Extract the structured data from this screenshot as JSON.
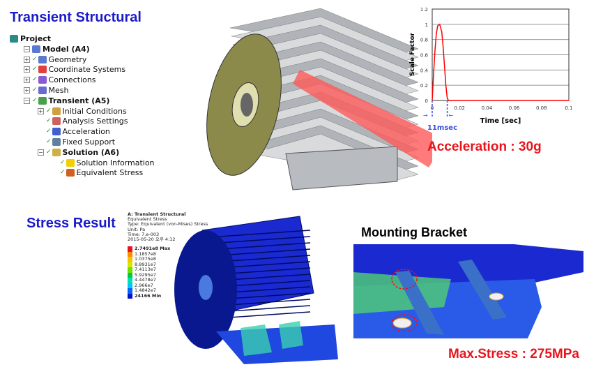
{
  "titles": {
    "transient": "Transient Structural",
    "stress": "Stress Result",
    "bracket": "Mounting Bracket"
  },
  "tree": [
    {
      "label": "Project",
      "bold": true,
      "icon": "project-icon"
    },
    {
      "label": "Model (A4)",
      "bold": true,
      "icon": "model-icon"
    },
    {
      "label": "Geometry",
      "icon": "geometry-icon"
    },
    {
      "label": "Coordinate Systems",
      "icon": "coordinate-systems-icon"
    },
    {
      "label": "Connections",
      "icon": "connections-icon"
    },
    {
      "label": "Mesh",
      "icon": "mesh-icon"
    },
    {
      "label": "Transient (A5)",
      "bold": true,
      "icon": "transient-icon"
    },
    {
      "label": "Initial Conditions",
      "icon": "initial-conditions-icon"
    },
    {
      "label": "Analysis Settings",
      "icon": "analysis-settings-icon"
    },
    {
      "label": "Acceleration",
      "icon": "acceleration-icon"
    },
    {
      "label": "Fixed Support",
      "icon": "fixed-support-icon"
    },
    {
      "label": "Solution (A6)",
      "bold": true,
      "icon": "solution-icon"
    },
    {
      "label": "Solution Information",
      "icon": "info-icon"
    },
    {
      "label": "Equivalent Stress",
      "icon": "stress-icon"
    }
  ],
  "annotations": {
    "acceleration": "Acceleration : 30g",
    "max_stress": "Max.Stress : 275MPa",
    "pulse": "11msec"
  },
  "result_legend": {
    "header": [
      "A: Transient Structural",
      "Equivalent Stress",
      "Type: Equivalent (von-Mises) Stress",
      "Unit: Pa",
      "Time: 7.e-003",
      "2015-05-20 오후 4:12"
    ],
    "levels": [
      "2.7491e8 Max",
      "1.1857e8",
      "1.0375e8",
      "8.8931e7",
      "7.4113e7",
      "5.9295e7",
      "4.4478e7",
      "2.966e7",
      "1.4842e7",
      "24166 Min"
    ],
    "colors": [
      "#e8141c",
      "#ff8a00",
      "#f5c400",
      "#d4e800",
      "#6fe000",
      "#00c84a",
      "#00e0b0",
      "#00c8ff",
      "#0064ff",
      "#0010d0"
    ]
  },
  "chart_data": {
    "type": "line",
    "xlabel": "Time [sec]",
    "ylabel": "Scale Factor",
    "xlim": [
      0,
      0.1
    ],
    "ylim": [
      0,
      1.2
    ],
    "xticks": [
      "0",
      "0.02",
      "0.04",
      "0.06",
      "0.08",
      "0.1"
    ],
    "yticks": [
      "0",
      "0.2",
      "0.4",
      "0.6",
      "0.8",
      "1",
      "1.2"
    ],
    "grid": true,
    "series": [
      {
        "color": "#ff0000",
        "x": [
          0,
          0.001,
          0.002,
          0.003,
          0.004,
          0.0055,
          0.007,
          0.008,
          0.009,
          0.01,
          0.011,
          0.012,
          0.1
        ],
        "y": [
          0,
          0.35,
          0.65,
          0.87,
          0.98,
          1.0,
          0.9,
          0.7,
          0.45,
          0.2,
          0.03,
          0,
          0
        ]
      }
    ]
  }
}
